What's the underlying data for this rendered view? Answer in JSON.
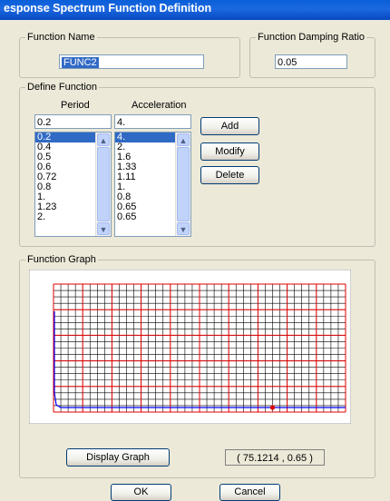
{
  "window": {
    "title": "esponse Spectrum  Function Definition"
  },
  "function_name": {
    "legend": "Function Name",
    "value": "FUNC2"
  },
  "damping": {
    "legend": "Function Damping Ratio",
    "value": "0.05"
  },
  "define": {
    "legend": "Define Function",
    "period_header": "Period",
    "accel_header": "Acceleration",
    "period_input": "0.2",
    "accel_input": "4.",
    "period_list": [
      "0.2",
      "0.4",
      "0.5",
      "0.6",
      "0.72",
      "0.8",
      "1.",
      "1.23",
      "2."
    ],
    "accel_list": [
      "4.",
      "2.",
      "1.6",
      "1.33",
      "1.11",
      "1.",
      "0.8",
      "0.65",
      "0.65"
    ],
    "add_label": "Add",
    "modify_label": "Modify",
    "delete_label": "Delete"
  },
  "graph": {
    "legend": "Function Graph",
    "display_label": "Display Graph",
    "readout": "( 75.1214  ,  0.65 )"
  },
  "footer": {
    "ok_label": "OK",
    "cancel_label": "Cancel"
  },
  "colors": {
    "grid_minor": "#000000",
    "grid_major": "#e00000",
    "curve": "#0000ff",
    "marker": "#e00000",
    "selection": "#316ac5"
  }
}
